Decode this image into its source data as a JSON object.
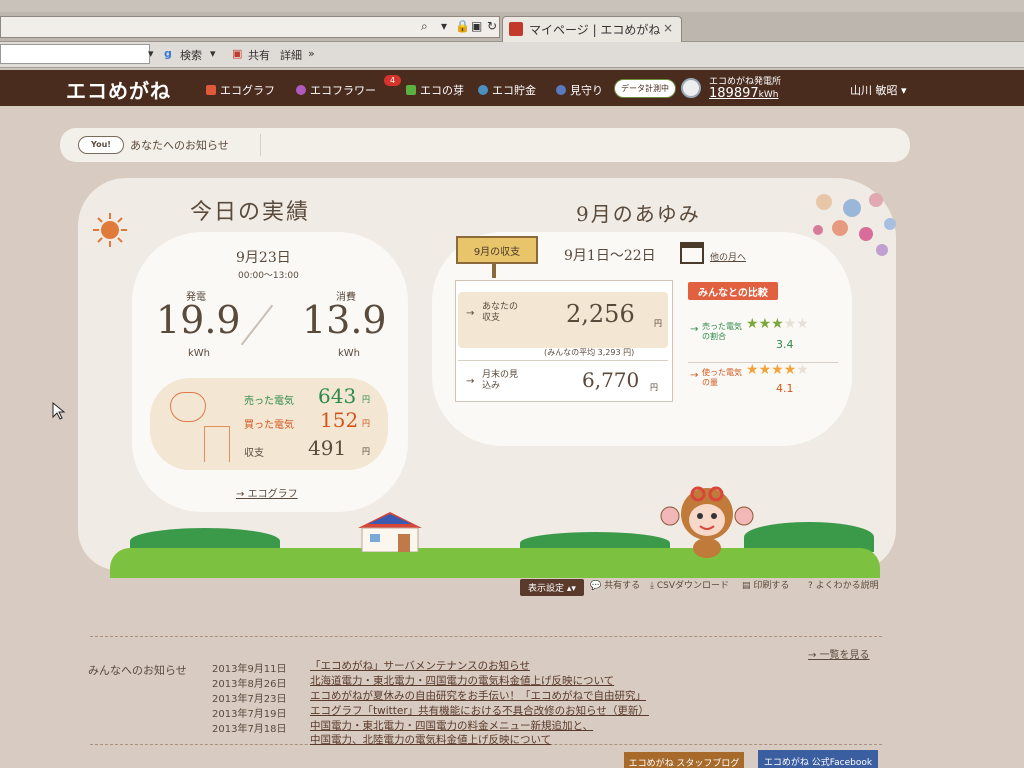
{
  "browser": {
    "tab_title": "マイページ | エコめがね",
    "tab_close": "×",
    "toolbar": {
      "search_label": "検索",
      "share_label": "共有",
      "detail_label": "詳細",
      "more": "»",
      "dropdown": "▾"
    }
  },
  "header": {
    "logo": "エコめがね",
    "nav": [
      {
        "label": "エコグラフ",
        "icon": "bar-chart-icon",
        "color": "#e05a3a"
      },
      {
        "label": "エコフラワー",
        "icon": "flower-icon",
        "color": "#b05ac0"
      },
      {
        "label": "エコの芽",
        "icon": "sprout-icon",
        "color": "#5ab040"
      },
      {
        "label": "エコ貯金",
        "icon": "coin-icon",
        "color": "#4a90c0"
      },
      {
        "label": "見守り",
        "icon": "watch-icon",
        "color": "#5a7ac0"
      }
    ],
    "flower_badge": "4",
    "data_pill": "データ計測中",
    "plant_label": "エコめがね発電所",
    "plant_value": "189897",
    "plant_unit": "kWh",
    "user": "山川 敏昭",
    "user_caret": "▾"
  },
  "notice": {
    "you_badge": "You!",
    "label": "あなたへのお知らせ"
  },
  "today": {
    "title": "今日の実績",
    "date": "9月23日",
    "time_range": "00:00～13:00",
    "generation_label": "発電",
    "generation_value": "19.9",
    "consumption_label": "消費",
    "consumption_value": "13.9",
    "unit": "kWh",
    "sold_label": "売った電気",
    "sold_value": "643",
    "bought_label": "買った電気",
    "bought_value": "152",
    "balance_label": "収支",
    "balance_value": "491",
    "yen": "円",
    "graph_link": "エコグラフ",
    "arrow": "→"
  },
  "month": {
    "title": "9月のあゆみ",
    "sign": "9月の収支",
    "range": "9月1日～22日",
    "other_month": "他の月へ",
    "your_balance_label": "あなたの収支",
    "your_balance_value": "2,256",
    "average_note": "(みんなの平均 3,293 円)",
    "forecast_label": "月末の見込み",
    "forecast_value": "6,770",
    "yen": "円",
    "arrow": "→",
    "compare_title": "みんなとの比較",
    "sold_ratio_label": "売った電気の割合",
    "sold_ratio_rating": 3.4,
    "sold_ratio_value": "3.4",
    "used_amount_label": "使った電気の量",
    "used_amount_rating": 4.1,
    "used_amount_value": "4.1"
  },
  "tools": {
    "display": "表示設定",
    "share": "共有する",
    "csv": "CSVダウンロード",
    "print": "印刷する",
    "help": "よくわかる説明"
  },
  "news": {
    "heading": "みんなへのお知らせ",
    "more": "一覧を見る",
    "items": [
      {
        "date": "2013年9月11日",
        "title": "「エコめがね」サーバメンテナンスのお知らせ"
      },
      {
        "date": "2013年8月26日",
        "title": "北海道電力・東北電力・四国電力の電気料金値上げ反映について"
      },
      {
        "date": "2013年7月23日",
        "title": "エコめがねが夏休みの自由研究をお手伝い！「エコめがねで自由研究」"
      },
      {
        "date": "2013年7月19日",
        "title": "エコグラフ「twitter」共有機能における不具合改修のお知らせ（更新）"
      },
      {
        "date": "2013年7月18日",
        "title": "中国電力・東北電力・四国電力の料金メニュー新規追加と、"
      }
    ],
    "item_continuation": "中国電力、北陸電力の電気料金値上げ反映について"
  },
  "footer": {
    "blog": "エコめがね スタッフブログ",
    "facebook": "エコめがね 公式Facebook"
  },
  "colors": {
    "brand": "#4a2c1f",
    "accent_orange": "#e06040",
    "accent_green": "#7aa83a",
    "star_orange": "#f2a43a"
  }
}
